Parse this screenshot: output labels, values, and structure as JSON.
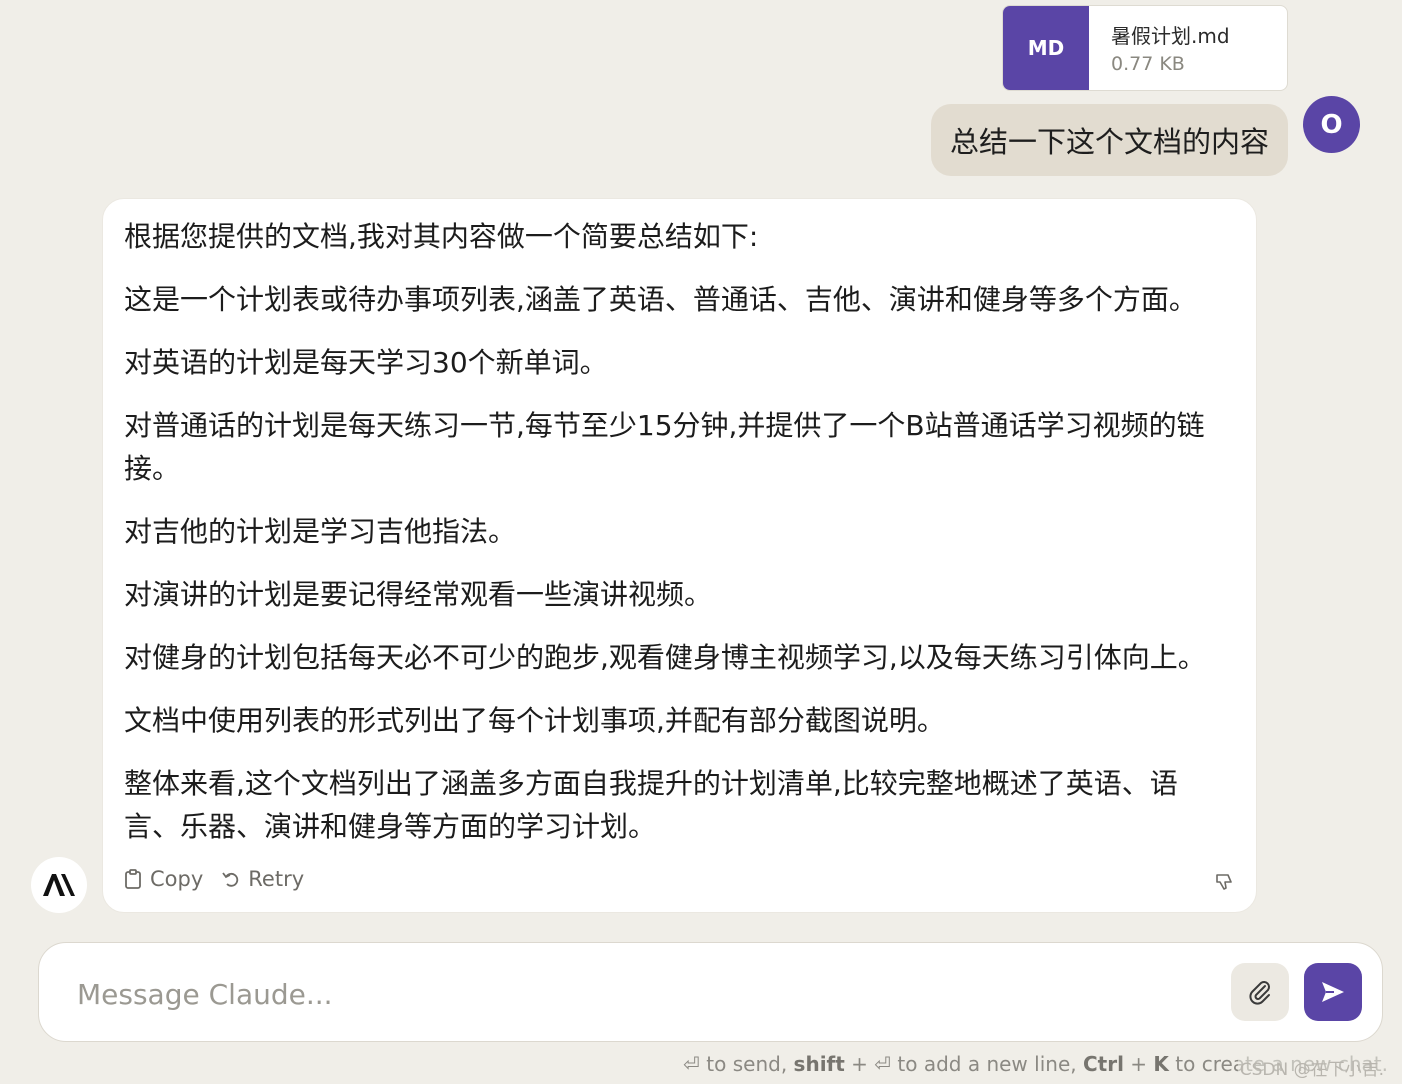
{
  "attachment": {
    "badge": "MD",
    "filename": "暑假计划.md",
    "size": "0.77 KB"
  },
  "user_message": {
    "text": "总结一下这个文档的内容",
    "avatar_letter": "O"
  },
  "assistant_message": {
    "paragraphs": [
      "根据您提供的文档,我对其内容做一个简要总结如下:",
      "这是一个计划表或待办事项列表,涵盖了英语、普通话、吉他、演讲和健身等多个方面。",
      "对英语的计划是每天学习30个新单词。",
      "对普通话的计划是每天练习一节,每节至少15分钟,并提供了一个B站普通话学习视频的链接。",
      "对吉他的计划是学习吉他指法。",
      "对演讲的计划是要记得经常观看一些演讲视频。",
      "对健身的计划包括每天必不可少的跑步,观看健身博主视频学习,以及每天练习引体向上。",
      "文档中使用列表的形式列出了每个计划事项,并配有部分截图说明。",
      "整体来看,这个文档列出了涵盖多方面自我提升的计划清单,比较完整地概述了英语、语言、乐器、演讲和健身等方面的学习计划。"
    ],
    "copy_label": "Copy",
    "retry_label": "Retry"
  },
  "composer": {
    "placeholder": "Message Claude..."
  },
  "hint": {
    "part1": "⏎ to send, ",
    "shift": "shift",
    "part2": " + ⏎ to add a new line, ",
    "ctrl": "Ctrl",
    "part3": " + ",
    "k": "K",
    "part4": " to create a new chat."
  },
  "watermark": "CSDN @在下小吉.",
  "colors": {
    "accent": "#5a45a6",
    "background": "#f0eee8",
    "user_bubble": "#e2dcd0"
  },
  "icons": [
    "clipboard-icon",
    "retry-icon",
    "thumbs-down-icon",
    "claude-logo-icon",
    "paperclip-icon",
    "send-arrow-icon"
  ]
}
